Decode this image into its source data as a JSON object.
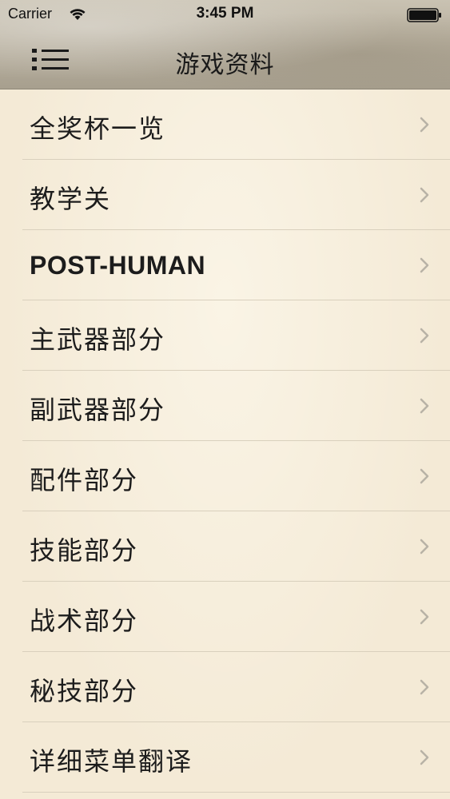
{
  "status_bar": {
    "carrier": "Carrier",
    "time": "3:45 PM",
    "wifi_icon": "wifi-icon",
    "battery_icon": "battery-icon"
  },
  "nav": {
    "title": "游戏资料",
    "menu_icon": "list-menu-icon"
  },
  "list": {
    "chevron_icon": "chevron-right-icon",
    "items": [
      {
        "label": "全奖杯一览"
      },
      {
        "label": "教学关"
      },
      {
        "label": "POST-HUMAN"
      },
      {
        "label": "主武器部分"
      },
      {
        "label": "副武器部分"
      },
      {
        "label": "配件部分"
      },
      {
        "label": "技能部分"
      },
      {
        "label": "战术部分"
      },
      {
        "label": "秘技部分"
      },
      {
        "label": "详细菜单翻译"
      }
    ]
  },
  "colors": {
    "background": "#f4ead6",
    "separator": "#d9d0bd",
    "chevron": "#b8b2a6",
    "text": "#1c1c1c"
  }
}
